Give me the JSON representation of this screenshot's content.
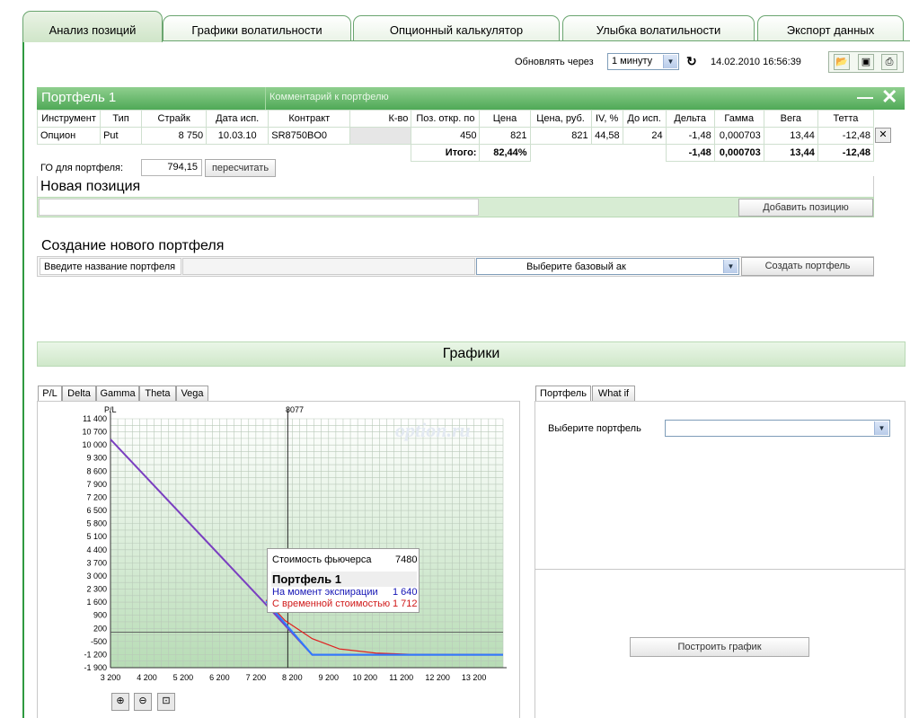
{
  "tabs": [
    "Анализ позиций",
    "Графики волатильности",
    "Опционный калькулятор",
    "Улыбка волатильности",
    "Экспорт данных"
  ],
  "refresh": {
    "label": "Обновлять через",
    "value": "1 минуту",
    "datetime": "14.02.2010 16:56:39"
  },
  "portfolio": {
    "title": "Портфель 1",
    "comment_placeholder": "Комментарий к портфелю",
    "columns": [
      "Инструмент",
      "Тип",
      "Страйк",
      "Дата исп.",
      "Контракт",
      "К-во",
      "Поз. откр. по",
      "Цена",
      "Цена, руб.",
      "IV, %",
      "До исп.",
      "Дельта",
      "Гамма",
      "Вега",
      "Тетта"
    ],
    "rows": [
      {
        "instrument": "Опцион",
        "type": "Put",
        "strike": "8 750",
        "date": "10.03.10",
        "contract": "SR8750BO0",
        "qty": "",
        "open_pos": "450",
        "price": "821",
        "price_rub": "821",
        "iv": "44,58",
        "days": "24",
        "delta": "-1,48",
        "gamma": "0,000703",
        "vega": "13,44",
        "theta": "-12,48"
      }
    ],
    "totals": {
      "label": "Итого:",
      "pct": "82,44%",
      "delta": "-1,48",
      "gamma": "0,000703",
      "vega": "13,44",
      "theta": "-12,48"
    },
    "go_label": "ГО для портфеля:",
    "go_value": "794,15",
    "recalc": "пересчитать"
  },
  "new_position": {
    "title": "Новая позиция",
    "add_button": "Добавить позицию"
  },
  "new_portfolio": {
    "title": "Создание нового портфеля",
    "name_label": "Введите название портфеля",
    "select_base": "Выберите базовый ак",
    "create_button": "Создать портфель"
  },
  "charts": {
    "title": "Графики",
    "subtabs": [
      "P/L",
      "Delta",
      "Gamma",
      "Theta",
      "Vega"
    ],
    "right_tabs": [
      "Портфель",
      "What if"
    ],
    "select_portfolio_label": "Выберите портфель",
    "build_button": "Построить график",
    "watermark": "option.ru",
    "cursor_label": "8077",
    "tooltip": {
      "futures_label": "Стоимость фьючерса",
      "futures_value": "7480",
      "portfolio": "Портфель 1",
      "expiry_label": "На момент экспирации",
      "expiry_value": "1 640",
      "time_label": "С временной стоимостью",
      "time_value": "1 712"
    }
  },
  "chart_data": {
    "type": "line",
    "ylabel": "P/L",
    "xlabel": "",
    "xlim": [
      3200,
      14000
    ],
    "ylim": [
      -1900,
      11400
    ],
    "x_ticks": [
      "3 200",
      "4 200",
      "5 200",
      "6 200",
      "7 200",
      "8 200",
      "9 200",
      "10 200",
      "11 200",
      "12 200",
      "13 200"
    ],
    "y_ticks": [
      "11 400",
      "10 700",
      "10 000",
      "9 300",
      "8 600",
      "7 900",
      "7 200",
      "6 500",
      "5 800",
      "5 100",
      "4 400",
      "3 700",
      "3 000",
      "2 300",
      "1 600",
      "900",
      "200",
      "-500",
      "-1 200",
      "-1 900"
    ],
    "series": [
      {
        "name": "На момент экспирации",
        "color": "#7a3fc0",
        "x": [
          3200,
          7400,
          8750,
          14000
        ],
        "y": [
          10300,
          1640,
          -1210,
          -1210
        ]
      },
      {
        "name": "С временной стоимостью",
        "color": "#e02020",
        "x": [
          7480,
          8000,
          8750,
          9500,
          10500,
          11500,
          14000
        ],
        "y": [
          1712,
          620,
          -350,
          -900,
          -1120,
          -1190,
          -1200
        ]
      }
    ],
    "grid": true
  },
  "colors": {
    "green_header": "#4fa957",
    "purple_line": "#7a3fc0",
    "blue_line": "#2f7bff",
    "red_line": "#e02020"
  }
}
